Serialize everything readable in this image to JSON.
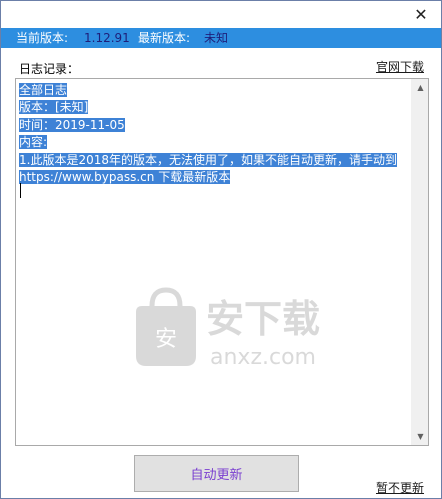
{
  "window": {
    "close_glyph": "✕"
  },
  "version_bar": {
    "current_label": "当前版本:",
    "current_value": "1.12.91",
    "latest_label": "最新版本:",
    "latest_value": "未知",
    "background": "#2d8ee0"
  },
  "log": {
    "label": "日志记录：",
    "official_download": "官网下载",
    "lines": [
      "全部日志",
      "版本：[未知]",
      "时间：2019-11-05",
      "内容:",
      "1.此版本是2018年的版本，无法使用了，如果不能自动更新，请手动到",
      "https://www.bypass.cn 下载最新版本"
    ],
    "selection_color": "#3e82d6"
  },
  "watermark": {
    "text_main": "安下载",
    "text_sub": "anxz.com",
    "bag_glyph": "安"
  },
  "footer": {
    "auto_update": "自动更新",
    "skip_update": "暂不更新"
  }
}
